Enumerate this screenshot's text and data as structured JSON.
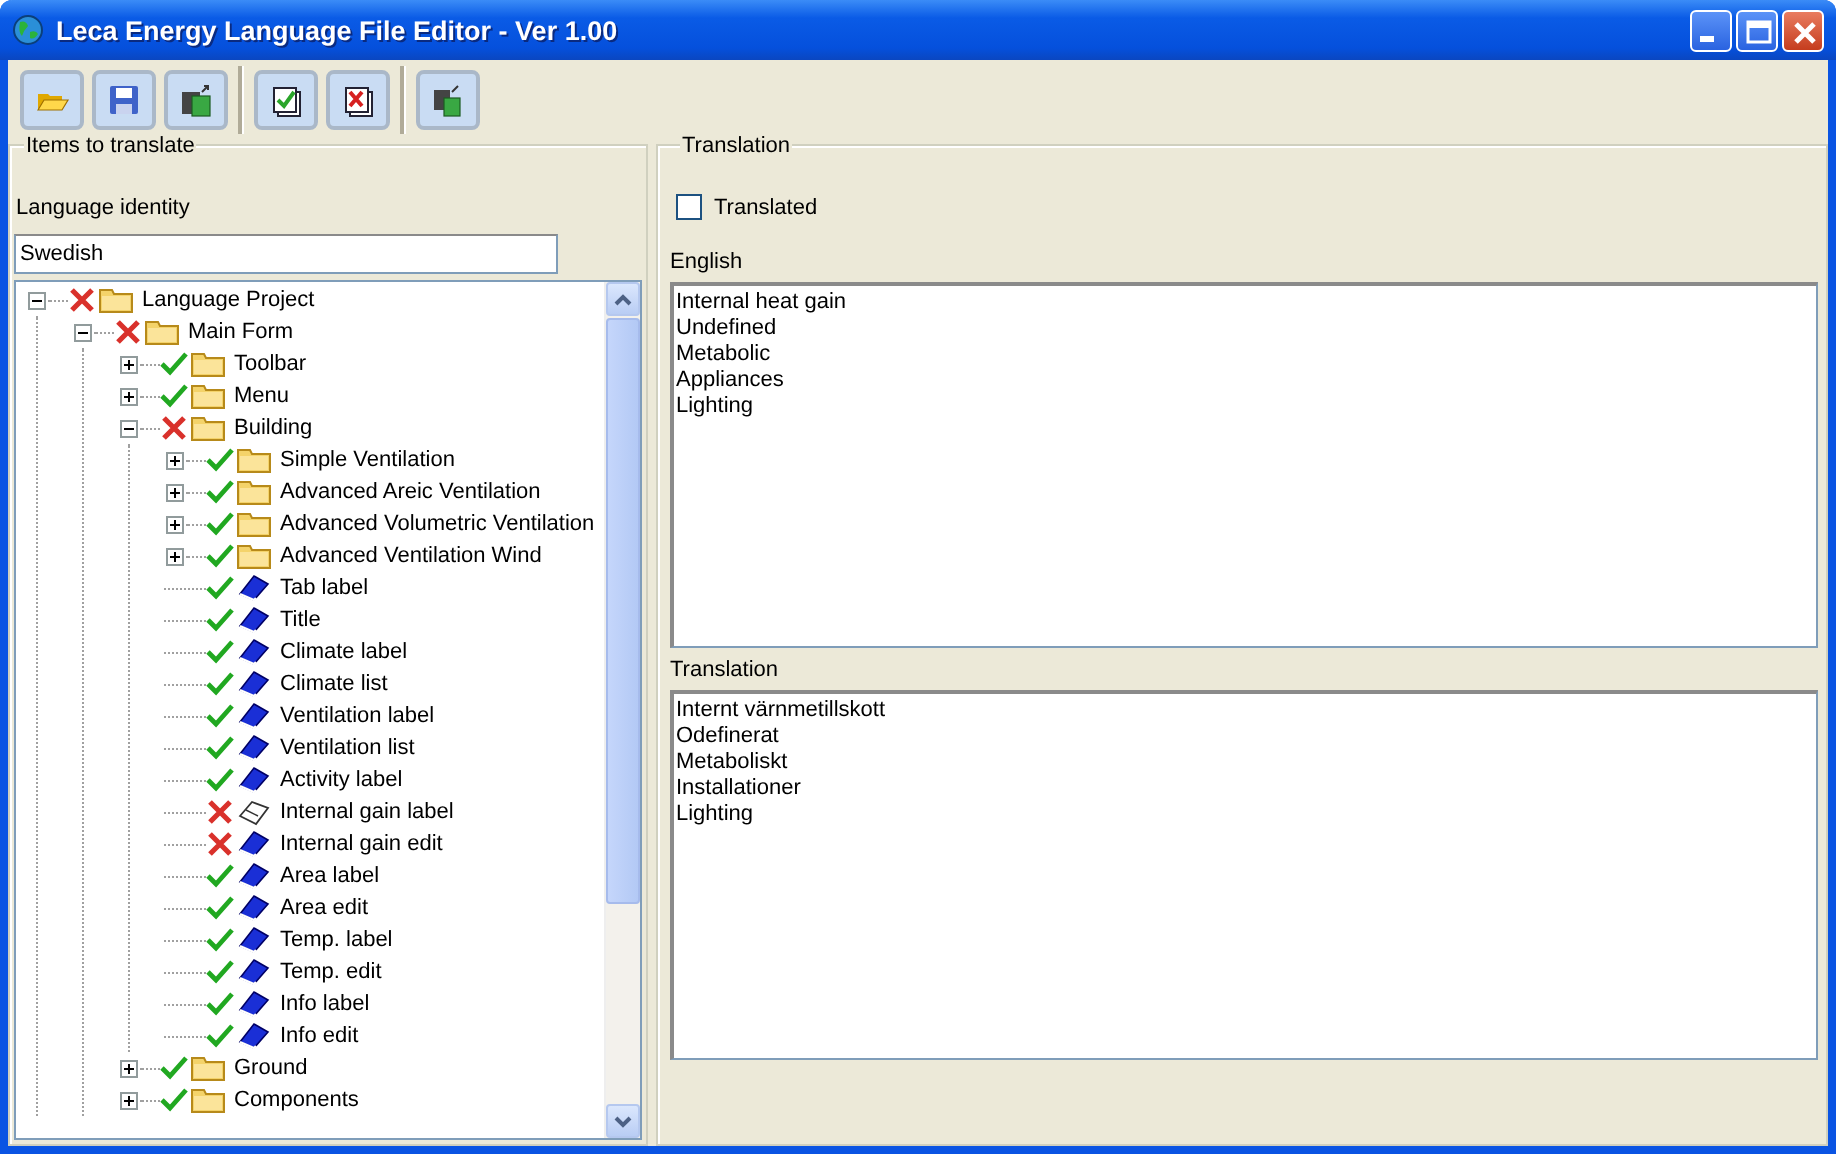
{
  "window": {
    "title": "Leca Energy Language File Editor - Ver 1.00"
  },
  "toolbar": [
    {
      "kind": "open"
    },
    {
      "kind": "save"
    },
    {
      "kind": "export"
    },
    {
      "kind": "separator"
    },
    {
      "kind": "mark-all"
    },
    {
      "kind": "unmark-all"
    },
    {
      "kind": "separator"
    },
    {
      "kind": "copy"
    }
  ],
  "items_panel": {
    "title": "Items to translate",
    "language_label": "Language identity",
    "language_value": "Swedish",
    "tree": [
      {
        "label": "Language Project",
        "kind": "folder",
        "translated": false,
        "expanded": true,
        "children": [
          {
            "label": "Main Form",
            "kind": "folder",
            "translated": false,
            "expanded": true,
            "children": [
              {
                "label": "Toolbar",
                "kind": "folder",
                "translated": true,
                "expanded": false
              },
              {
                "label": "Menu",
                "kind": "folder",
                "translated": true,
                "expanded": false
              },
              {
                "label": "Building",
                "kind": "folder",
                "translated": false,
                "expanded": true,
                "children": [
                  {
                    "label": "Simple Ventilation",
                    "kind": "folder",
                    "translated": true,
                    "expanded": false
                  },
                  {
                    "label": "Advanced Areic Ventilation",
                    "kind": "folder",
                    "translated": true,
                    "expanded": false
                  },
                  {
                    "label": "Advanced Volumetric Ventilation",
                    "kind": "folder",
                    "translated": true,
                    "expanded": false
                  },
                  {
                    "label": "Advanced Ventilation Wind",
                    "kind": "folder",
                    "translated": true,
                    "expanded": false
                  },
                  {
                    "label": "Tab label",
                    "kind": "text",
                    "translated": true
                  },
                  {
                    "label": "Title",
                    "kind": "text",
                    "translated": true
                  },
                  {
                    "label": "Climate label",
                    "kind": "text",
                    "translated": true
                  },
                  {
                    "label": "Climate list",
                    "kind": "text",
                    "translated": true
                  },
                  {
                    "label": "Ventilation label",
                    "kind": "text",
                    "translated": true
                  },
                  {
                    "label": "Ventilation list",
                    "kind": "text",
                    "translated": true
                  },
                  {
                    "label": "Activity label",
                    "kind": "text",
                    "translated": true
                  },
                  {
                    "label": "Internal gain label",
                    "kind": "blank",
                    "translated": false
                  },
                  {
                    "label": "Internal gain edit",
                    "kind": "text",
                    "translated": false
                  },
                  {
                    "label": "Area label",
                    "kind": "text",
                    "translated": true
                  },
                  {
                    "label": "Area edit",
                    "kind": "text",
                    "translated": true
                  },
                  {
                    "label": "Temp. label",
                    "kind": "text",
                    "translated": true
                  },
                  {
                    "label": "Temp. edit",
                    "kind": "text",
                    "translated": true
                  },
                  {
                    "label": "Info label",
                    "kind": "text",
                    "translated": true
                  },
                  {
                    "label": "Info edit",
                    "kind": "text",
                    "translated": true
                  }
                ]
              },
              {
                "label": "Ground",
                "kind": "folder",
                "translated": true,
                "expanded": false
              },
              {
                "label": "Components",
                "kind": "folder",
                "translated": true,
                "expanded": false
              }
            ]
          }
        ]
      }
    ]
  },
  "translation_panel": {
    "title": "Translation",
    "translated_checkbox": {
      "label": "Translated",
      "checked": false
    },
    "english_label": "English",
    "english_lines": [
      "Internal heat gain",
      "Undefined",
      "Metabolic",
      "Appliances",
      "Lighting"
    ],
    "translation_label": "Translation",
    "translation_lines": [
      "Internt värnmetillskott",
      "Odefinerat",
      "Metaboliskt",
      "Installationer",
      "Lighting"
    ]
  }
}
